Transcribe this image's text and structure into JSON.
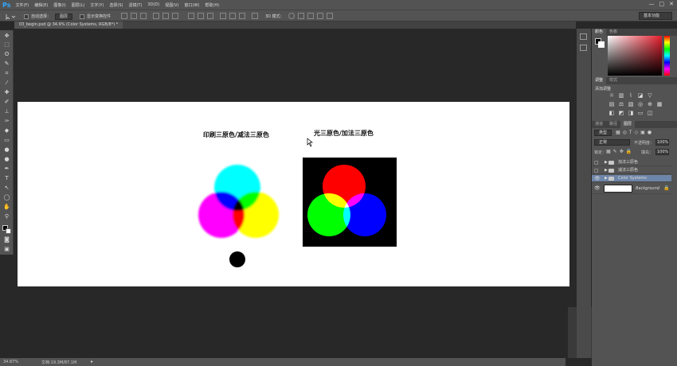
{
  "app": {
    "logo": "Ps",
    "menu": [
      "文件(F)",
      "编辑(E)",
      "图像(I)",
      "图层(L)",
      "文字(Y)",
      "选择(S)",
      "滤镜(T)",
      "3D(D)",
      "视图(V)",
      "窗口(W)",
      "帮助(H)"
    ],
    "window_controls": [
      "—",
      "□",
      "✕"
    ]
  },
  "options_bar": {
    "auto_select_label": "自动选择：",
    "auto_select_value": "图层",
    "show_transform_label": "显示变换控件",
    "mode_3d_label": "3D 模式：",
    "workspace": "基本功能"
  },
  "document": {
    "tab_title": "03_begin.psd @ 34.9% (Color Systems, RGB/8*) *",
    "left_caption": "印刷三原色/减法三原色",
    "right_caption": "光三原色/加法三原色"
  },
  "status": {
    "zoom": "34.87%",
    "doc_info": "文档:19.3M/87.1M"
  },
  "panels": {
    "color_tabs": [
      "颜色",
      "色板"
    ],
    "adjust_tabs": [
      "调整",
      "样式"
    ],
    "adjust_title": "添加调整",
    "layers_tabs": [
      "通道",
      "路径",
      "图层"
    ],
    "kind_filter": "类型",
    "blend_mode": "正常",
    "opacity_label": "不透明度：",
    "opacity_value": "100%",
    "lock_label": "锁定：",
    "fill_label": "填充：",
    "fill_value": "100%",
    "layers": [
      {
        "name": "加法三原色",
        "type": "folder",
        "visible": false,
        "selected": false
      },
      {
        "name": "减法三原色",
        "type": "folder",
        "visible": false,
        "selected": false
      },
      {
        "name": "Color Systems",
        "type": "folder",
        "visible": true,
        "selected": true
      },
      {
        "name": "Background",
        "type": "background",
        "visible": true,
        "selected": false
      }
    ]
  },
  "colors": {
    "cyan": "#00ffff",
    "magenta": "#ff00ff",
    "yellow": "#ffff00",
    "red": "#ff0000",
    "green": "#00ff00",
    "blue": "#0000ff",
    "selected_layer": "#6d85a8"
  }
}
